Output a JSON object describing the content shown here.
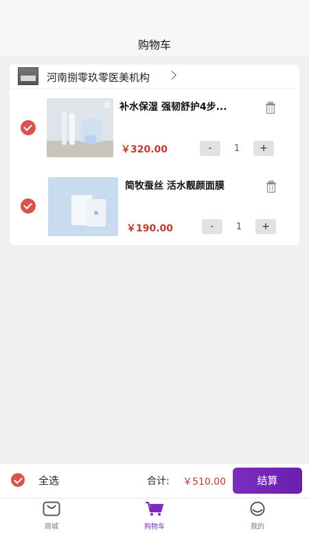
{
  "header": {
    "title": "购物车"
  },
  "store": {
    "name": "河南捌零玖零医美机构"
  },
  "items": [
    {
      "name": "补水保湿 强韧舒护4步...",
      "price": "￥320.00",
      "qty": "1",
      "minus": "-",
      "plus": "+"
    },
    {
      "name": "简牧蚕丝 活水靓颜面膜",
      "price": "￥190.00",
      "qty": "1",
      "minus": "-",
      "plus": "+"
    }
  ],
  "footer": {
    "select_all": "全选",
    "total_label": "合计:",
    "total_value": "￥510.00",
    "checkout": "结算"
  },
  "tabs": [
    {
      "label": "商城",
      "icon": "shop-bag-icon"
    },
    {
      "label": "购物车",
      "icon": "cart-icon",
      "active": true
    },
    {
      "label": "我的",
      "icon": "profile-face-icon"
    }
  ],
  "colors": {
    "accent": "#7b2cbf",
    "check": "#d9534f",
    "price": "#c0392b"
  }
}
